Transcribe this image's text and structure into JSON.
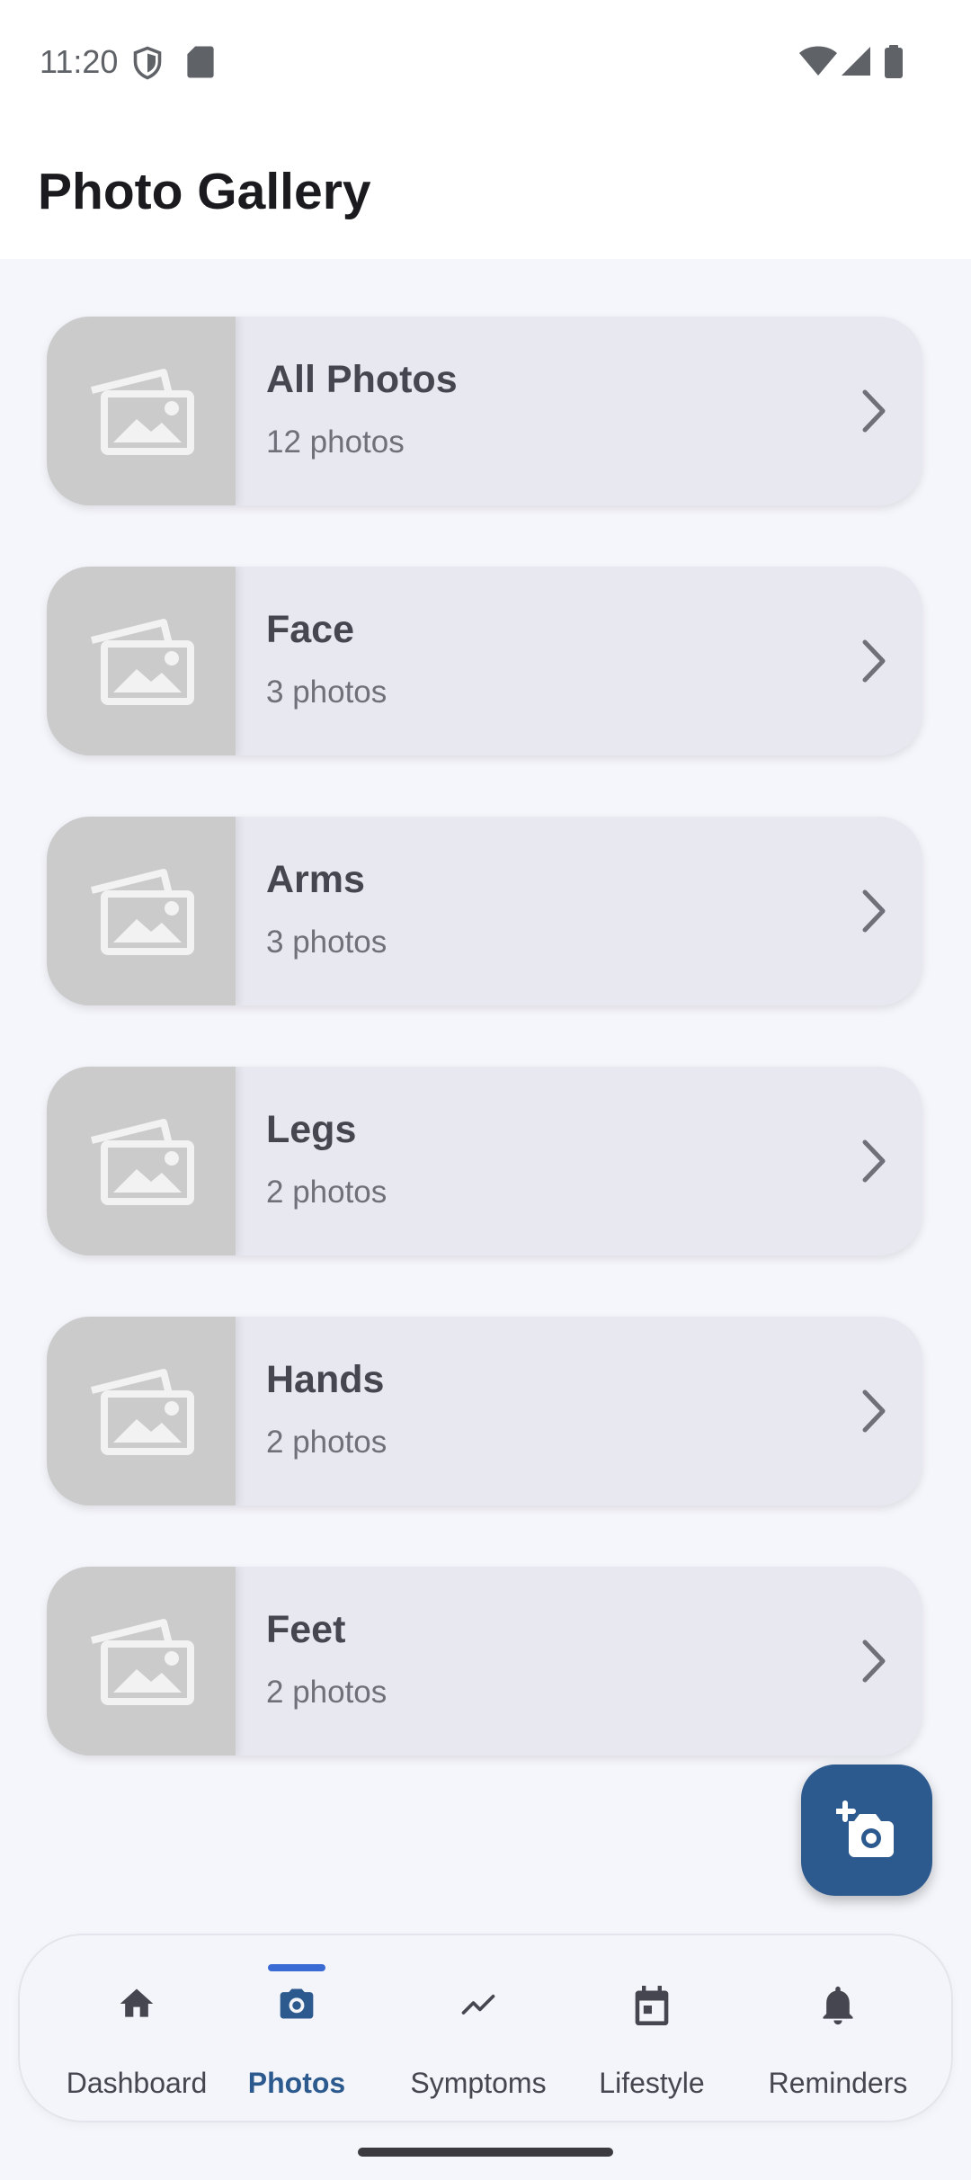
{
  "status_bar": {
    "time": "11:20"
  },
  "app_bar": {
    "title": "Photo Gallery"
  },
  "albums": [
    {
      "name": "All Photos",
      "count": "12 photos"
    },
    {
      "name": "Face",
      "count": "3 photos"
    },
    {
      "name": "Arms",
      "count": "3 photos"
    },
    {
      "name": "Legs",
      "count": "2 photos"
    },
    {
      "name": "Hands",
      "count": "2 photos"
    },
    {
      "name": "Feet",
      "count": "2 photos"
    }
  ],
  "fab": {
    "icon": "add-photo-camera-icon"
  },
  "bottom_nav": {
    "items": [
      {
        "label": "Dashboard",
        "icon": "home-icon",
        "active": false
      },
      {
        "label": "Photos",
        "icon": "camera-icon",
        "active": true
      },
      {
        "label": "Symptoms",
        "icon": "trending-icon",
        "active": false
      },
      {
        "label": "Lifestyle",
        "icon": "calendar-icon",
        "active": false
      },
      {
        "label": "Reminders",
        "icon": "bell-icon",
        "active": false
      }
    ]
  },
  "colors": {
    "primary": "#2c5a8e",
    "indicator": "#3a6bd4",
    "card_background": "#e8e8f0",
    "thumbnail_placeholder": "#cbcbcb",
    "page_background": "#f5f6fb"
  }
}
